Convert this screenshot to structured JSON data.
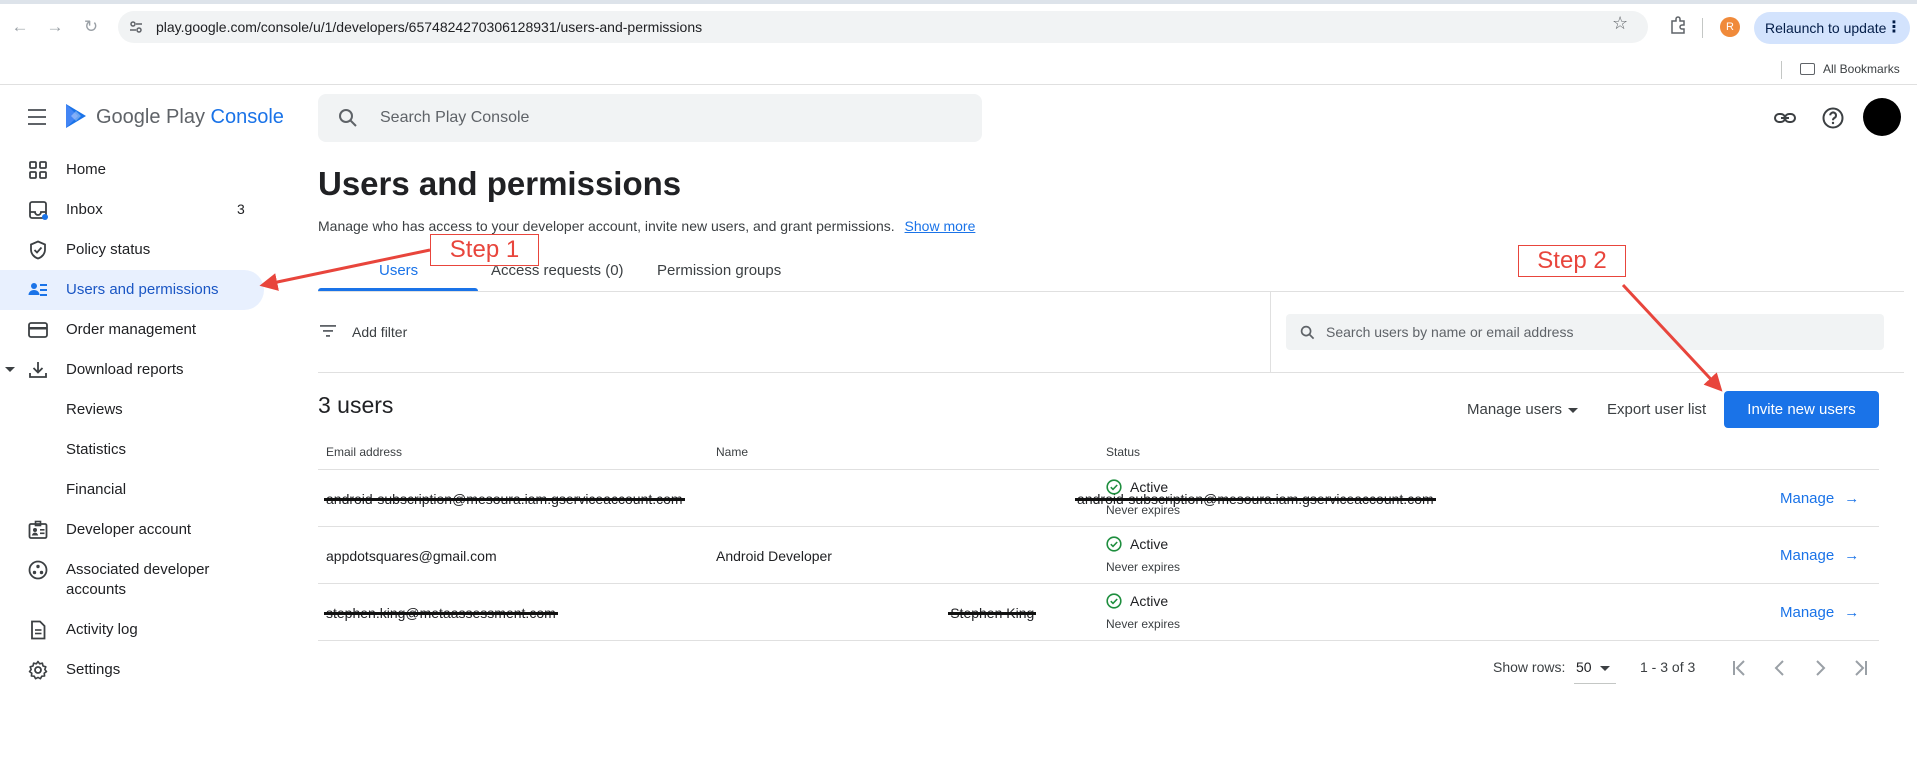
{
  "browser": {
    "url": "play.google.com/console/u/1/developers/6574824270306128931/users-and-permissions",
    "profile_initial": "R",
    "relaunch_label": "Relaunch to update",
    "bookmarks_label": "All Bookmarks"
  },
  "header": {
    "logo_text": "Google Play",
    "logo_accent": "Console",
    "search_placeholder": "Search Play Console"
  },
  "sidebar": {
    "items": [
      {
        "label": "Home",
        "icon": "grid-icon"
      },
      {
        "label": "Inbox",
        "icon": "inbox-icon",
        "count": "3"
      },
      {
        "label": "Policy status",
        "icon": "shield-check-icon"
      },
      {
        "label": "Users and permissions",
        "icon": "users-list-icon",
        "active": true
      },
      {
        "label": "Order management",
        "icon": "credit-card-icon"
      },
      {
        "label": "Download reports",
        "icon": "download-icon"
      },
      {
        "label": "Reviews"
      },
      {
        "label": "Statistics"
      },
      {
        "label": "Financial"
      },
      {
        "label": "Developer account",
        "icon": "badge-icon"
      },
      {
        "label": "Associated developer",
        "label2": "accounts",
        "icon": "connected-icon"
      },
      {
        "label": "Activity log",
        "icon": "document-icon"
      },
      {
        "label": "Settings",
        "icon": "gear-icon"
      }
    ]
  },
  "main": {
    "title": "Users and permissions",
    "description": "Manage who has access to your developer account, invite new users, and grant permissions.",
    "show_more": "Show more",
    "tabs": [
      {
        "label": "Users",
        "active": true
      },
      {
        "label": "Access requests (0)"
      },
      {
        "label": "Permission groups"
      }
    ],
    "filter_label": "Add filter",
    "users_search_placeholder": "Search users by name or email address",
    "count_title": "3 users",
    "manage_users_label": "Manage users",
    "export_label": "Export user list",
    "invite_label": "Invite new users",
    "table": {
      "headers": [
        "Email address",
        "Name",
        "Status"
      ],
      "rows": [
        {
          "email": "android-subscription@mesoura.iam.gserviceaccount.com",
          "name": "android-subscription@mesoura.iam.gserviceaccount.com",
          "status": "Active",
          "expiry": "Never expires",
          "manage": "Manage",
          "redacted": true
        },
        {
          "email": "appdotsquares@gmail.com",
          "name": "Android Developer",
          "status": "Active",
          "expiry": "Never expires",
          "manage": "Manage",
          "redacted": false
        },
        {
          "email": "stephen.king@metaassessment.com",
          "name": "Stephen King",
          "status": "Active",
          "expiry": "Never expires",
          "manage": "Manage",
          "redacted": true
        }
      ]
    },
    "pagination": {
      "show_rows_label": "Show rows:",
      "rows_value": "50",
      "range": "1 - 3 of 3"
    }
  },
  "annotations": {
    "step1": "Step 1",
    "step2": "Step 2",
    "color": "#e8453c"
  },
  "colors": {
    "accent": "#1a73e8",
    "active_nav_bg": "#e8f0fe",
    "status_green": "#1e8e3e"
  }
}
